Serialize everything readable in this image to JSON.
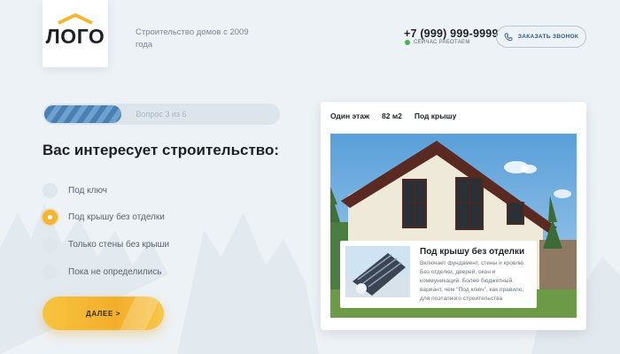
{
  "header": {
    "logo_text": "ЛОГО",
    "tagline": "Строительство домов с 2009 года",
    "phone": "+7 (999) 999-9999",
    "status": "Сейчас работаем",
    "callback_label": "Заказать звонок"
  },
  "quiz": {
    "progress_label": "Вопрос 3 из 6",
    "progress_fraction": 0.33,
    "question": "Вас интересует строительство:",
    "options": [
      {
        "label": "Под ключ",
        "selected": false
      },
      {
        "label": "Под крышу без отделки",
        "selected": true
      },
      {
        "label": "Только стены без крыши",
        "selected": false
      },
      {
        "label": "Пока не определились",
        "selected": false
      }
    ],
    "next_label": "ДАЛЕЕ >"
  },
  "card": {
    "tabs": [
      "Один этаж",
      "82 м2",
      "Под крышу"
    ],
    "info_title": "Под крышу без отделки",
    "info_desc": "Включает фундамент, стены и кровлю. Без отделки, дверей, окон и коммуникаций. Более бюджетный вариант, чем \"Под ключ\", как правило, для поэтапного строительства"
  },
  "colors": {
    "accent": "#f4b531",
    "progress": "#4a7fb3",
    "background": "#edf2f6"
  }
}
